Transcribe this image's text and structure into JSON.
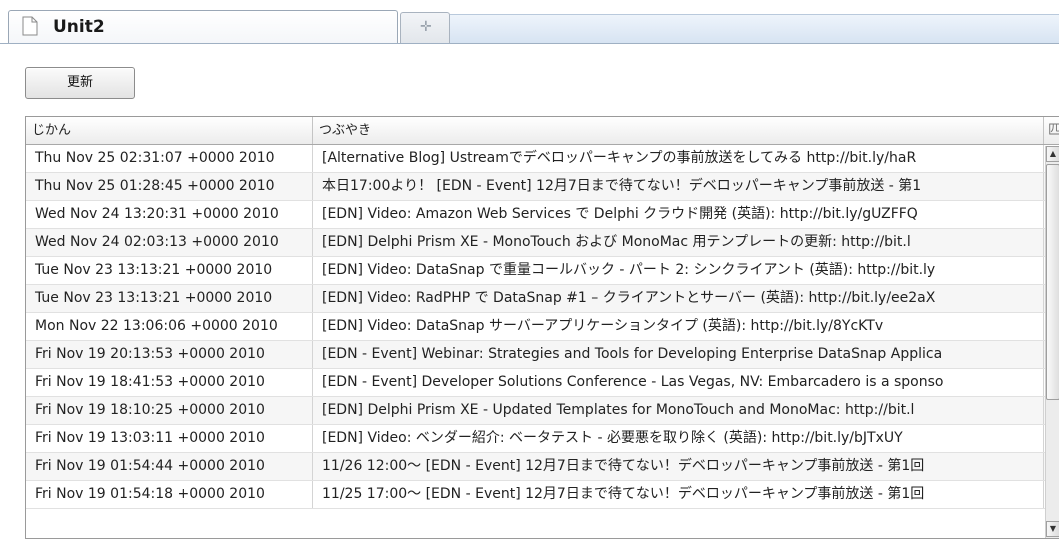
{
  "tabs": [
    {
      "label": "Unit2",
      "icon": "document-icon",
      "active": true
    },
    {
      "label": "",
      "icon": "new-tab-icon",
      "active": false
    }
  ],
  "toolbar": {
    "refresh_label": "更新"
  },
  "grid": {
    "columns": [
      "じかん",
      "つぶやき",
      "匹"
    ],
    "rows": [
      [
        "Thu Nov 25 02:31:07 +0000 2010",
        "[Alternative Blog] Ustreamでデベロッパーキャンプの事前放送をしてみる http://bit.ly/haR"
      ],
      [
        "Thu Nov 25 01:28:45 +0000 2010",
        "本日17:00より！ [EDN - Event] 12月7日まで待てない！デベロッパーキャンプ事前放送 - 第1"
      ],
      [
        "Wed Nov 24 13:20:31 +0000 2010",
        "[EDN] Video: Amazon Web Services で Delphi クラウド開発 (英語): http://bit.ly/gUZFFQ"
      ],
      [
        "Wed Nov 24 02:03:13 +0000 2010",
        "[EDN] Delphi Prism XE - MonoTouch および MonoMac 用テンプレートの更新: http://bit.l"
      ],
      [
        "Tue Nov 23 13:13:21 +0000 2010",
        "[EDN] Video: DataSnap で重量コールバック - パート 2: シンクライアント (英語): http://bit.ly"
      ],
      [
        "Tue Nov 23 13:13:21 +0000 2010",
        "[EDN] Video: RadPHP で DataSnap #1 – クライアントとサーバー (英語): http://bit.ly/ee2aX"
      ],
      [
        "Mon Nov 22 13:06:06 +0000 2010",
        "[EDN] Video: DataSnap サーバーアプリケーションタイプ (英語): http://bit.ly/8YcKTv"
      ],
      [
        "Fri Nov 19 20:13:53 +0000 2010",
        "[EDN - Event] Webinar: Strategies and Tools for Developing Enterprise DataSnap Applica"
      ],
      [
        "Fri Nov 19 18:41:53 +0000 2010",
        "[EDN - Event] Developer Solutions Conference - Las Vegas, NV: Embarcadero is a sponso"
      ],
      [
        "Fri Nov 19 18:10:25 +0000 2010",
        "[EDN] Delphi Prism XE - Updated Templates for MonoTouch and MonoMac: http://bit.l"
      ],
      [
        "Fri Nov 19 13:03:11 +0000 2010",
        "[EDN] Video: ベンダー紹介: ベータテスト - 必要悪を取り除く (英語): http://bit.ly/bJTxUY"
      ],
      [
        "Fri Nov 19 01:54:44 +0000 2010",
        "11/26 12:00〜 [EDN - Event] 12月7日まで待てない！デベロッパーキャンプ事前放送 - 第1回"
      ],
      [
        "Fri Nov 19 01:54:18 +0000 2010",
        "11/25 17:00〜 [EDN - Event] 12月7日まで待てない！デベロッパーキャンプ事前放送 - 第1回"
      ]
    ]
  },
  "scrollbar": {
    "up_glyph": "▲",
    "down_glyph": "▼"
  }
}
